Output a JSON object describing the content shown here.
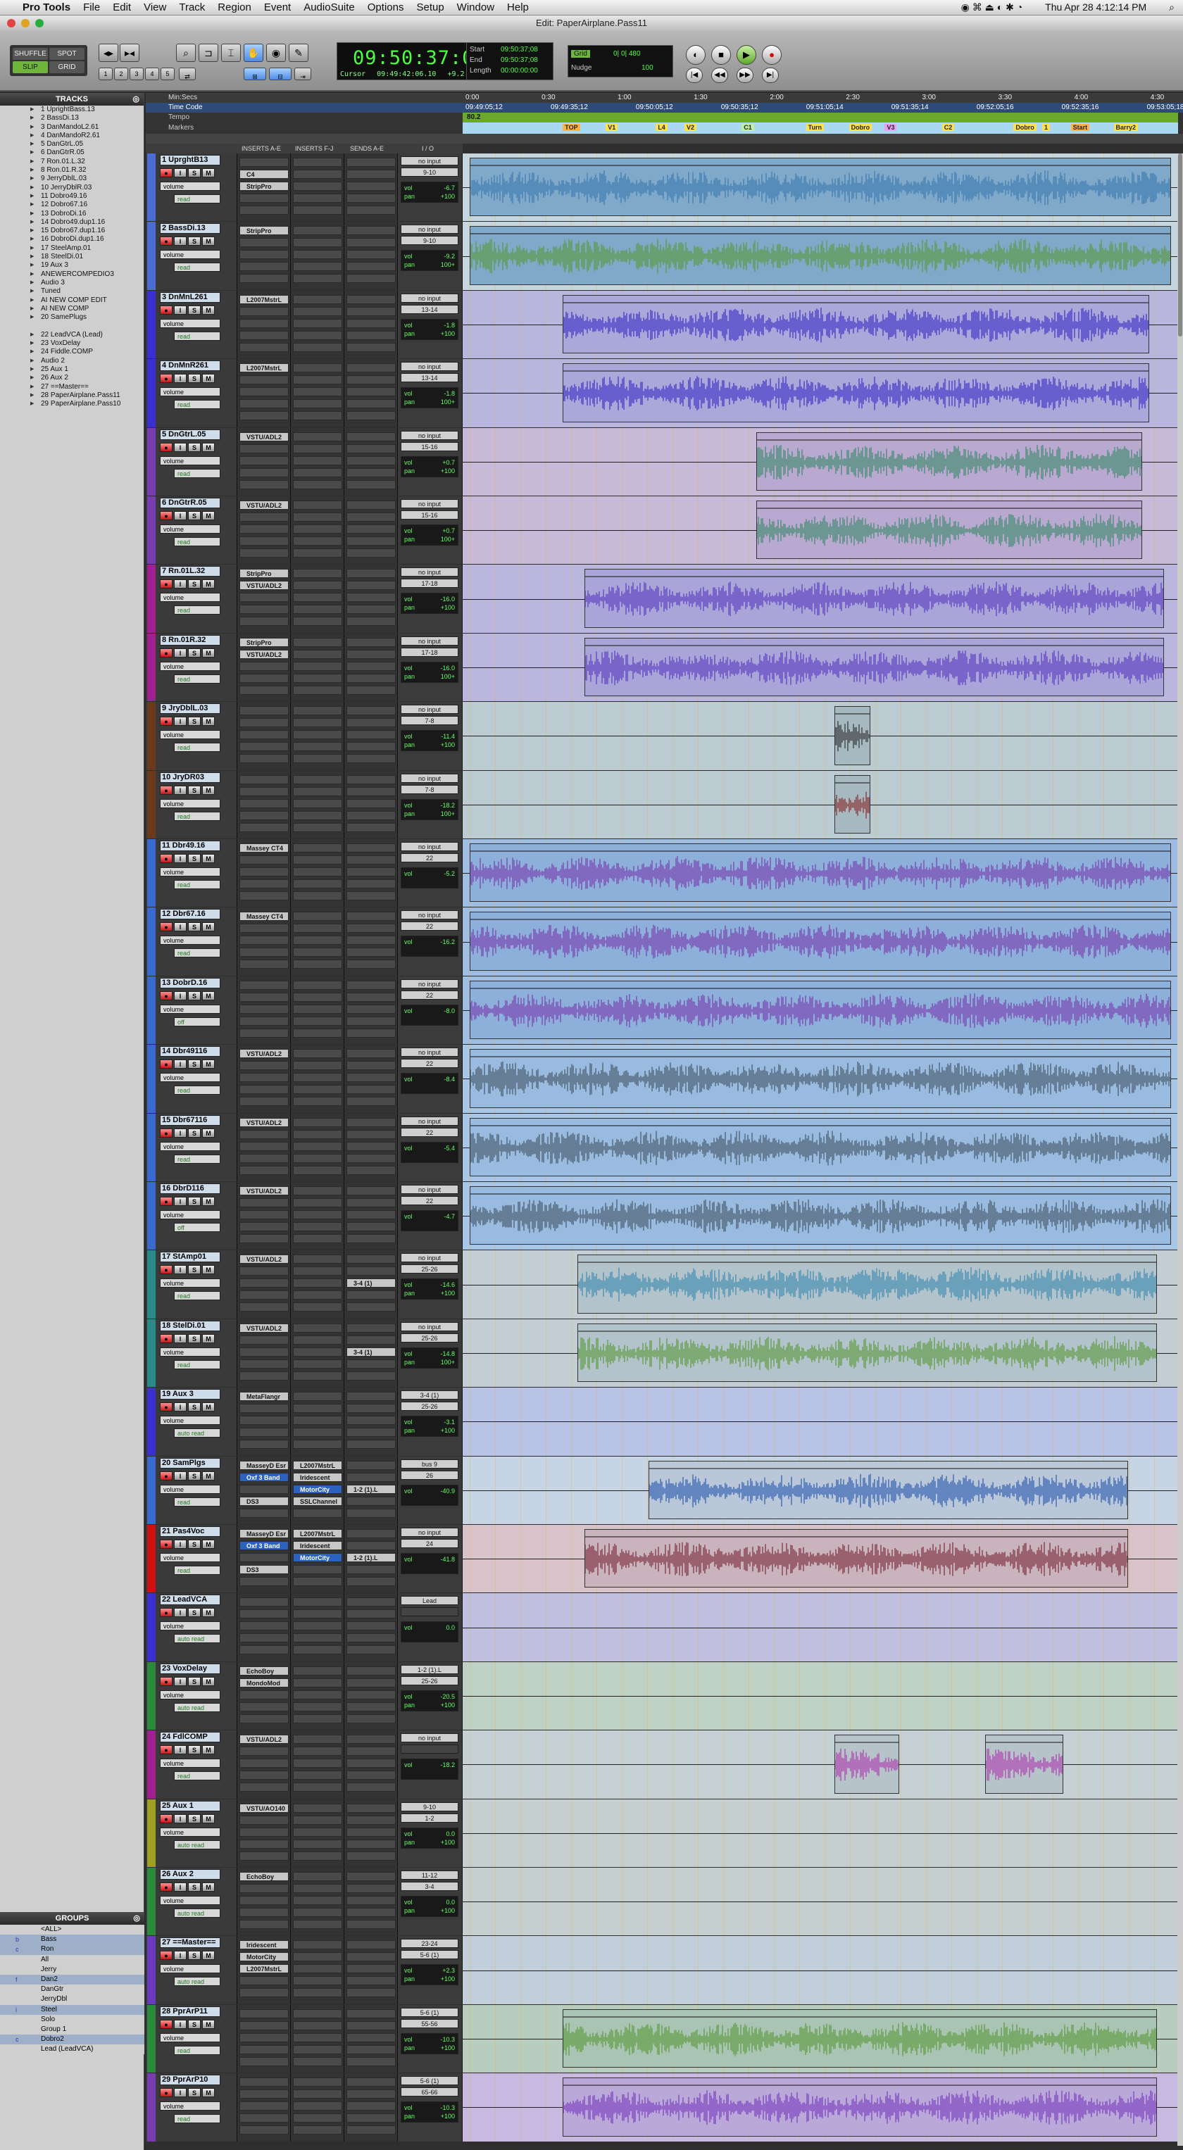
{
  "menubar": {
    "app": "Pro Tools",
    "items": [
      "File",
      "Edit",
      "View",
      "Track",
      "Region",
      "Event",
      "AudioSuite",
      "Options",
      "Setup",
      "Window",
      "Help"
    ],
    "clock": "Thu Apr 28  4:12:14 PM"
  },
  "window": {
    "title": "Edit: PaperAirplane.Pass11"
  },
  "toolbar": {
    "modes": [
      "SHUFFLE",
      "SPOT",
      "SLIP",
      "GRID"
    ],
    "zoom_presets": [
      "1",
      "2",
      "3",
      "4",
      "5"
    ],
    "main_counter": "09:50:37:08",
    "cursor_label": "Cursor",
    "cursor_value": "09:49:42:06.10",
    "cursor_db": "+9.2 db",
    "sel_start_label": "Start",
    "sel_end_label": "End",
    "sel_length_label": "Length",
    "sel_start": "09:50:37;08",
    "sel_end": "09:50:37;08",
    "sel_length": "00:00:00:00",
    "grid_label": "Grid",
    "grid_value": "0| 0| 480",
    "nudge_label": "Nudge",
    "nudge_value": "100",
    "transport": [
      "return",
      "stop",
      "play",
      "record"
    ]
  },
  "tracks_panel": {
    "title": "TRACKS",
    "items": [
      "1 UprightBass.13",
      "2 BassDi.13",
      "3 DanMandoL2.61",
      "4 DanMandoR2.61",
      "5 DanGtrL.05",
      "6 DanGtrR.05",
      "7 Ron.01.L.32",
      "8 Ron.01.R.32",
      "9 JerryDblL.03",
      "10 JerryDblR.03",
      "11 Dobro49.16",
      "12 Dobro67.16",
      "13 DobroDi.16",
      "14 Dobro49.dup1.16",
      "15 Dobro67.dup1.16",
      "16 DobroDi.dup1.16",
      "17 SteelAmp.01",
      "18 SteelDi.01",
      "19 Aux 3",
      "  ANEWERCOMPEDIO3",
      "Audio 3",
      "Tuned",
      "AI NEW COMP EDIT",
      "AI NEW COMP",
      "20 SamePlugs",
      "21 Pass4Voc",
      "22 LeadVCA (Lead)",
      "23 VoxDelay",
      "24 Fiddle.COMP",
      "Audio 2",
      "25 Aux 1",
      "26 Aux 2",
      "27 ==Master==",
      "28 PaperAirplane.Pass11",
      "29 PaperAirplane.Pass10"
    ],
    "selected_index": 25
  },
  "groups_panel": {
    "title": "GROUPS",
    "items": [
      {
        "letter": "",
        "name": "<ALL>"
      },
      {
        "letter": "b",
        "name": "Bass"
      },
      {
        "letter": "c",
        "name": "Ron"
      },
      {
        "letter": "",
        "name": "All"
      },
      {
        "letter": "",
        "name": "Jerry"
      },
      {
        "letter": "f",
        "name": "Dan2"
      },
      {
        "letter": "",
        "name": "DanGtr"
      },
      {
        "letter": "",
        "name": "JerryDbl"
      },
      {
        "letter": "i",
        "name": "Steel"
      },
      {
        "letter": "",
        "name": "Solo"
      },
      {
        "letter": "",
        "name": "Group 1"
      },
      {
        "letter": "c",
        "name": "Dobro2"
      },
      {
        "letter": "",
        "name": "Lead (LeadVCA)"
      }
    ]
  },
  "rulers": {
    "min_secs_label": "Min:Secs",
    "timecode_label": "Time Code",
    "tempo_label": "Tempo",
    "markers_label": "Markers",
    "min_secs_ticks": [
      "0:00",
      "0:30",
      "1:00",
      "1:30",
      "2:00",
      "2:30",
      "3:00",
      "3:30",
      "4:00",
      "4:30"
    ],
    "timecode_ticks": [
      "09:49:05;12",
      "09:49:35;12",
      "09:50:05;12",
      "09:50:35;12",
      "09:51:05;14",
      "09:51:35;14",
      "09:52:05;16",
      "09:52:35;16",
      "09:53:05;18"
    ],
    "tempo_value": "80.2",
    "markers": [
      "TOP",
      "V1",
      "L4",
      "V2",
      "C1",
      "Turn",
      "Dobro",
      "V3",
      "C2",
      "Dobro",
      "1",
      "Start",
      "Barry2"
    ]
  },
  "edit_headers": {
    "inserts_a": "INSERTS A-E",
    "inserts_f": "INSERTS F-J",
    "sends": "SENDS A-E",
    "io": "I / O"
  },
  "tracks": [
    {
      "name": "1 UprghtB13",
      "color": "#4a6cd4",
      "view": "volume",
      "auto": "read",
      "dyn": true,
      "insA": [
        "",
        "C4",
        "StripPro"
      ],
      "insF": [],
      "send": "",
      "input": "no input",
      "output": "9-10",
      "vol": "-6.7",
      "pan": "+100",
      "lane": "#c6d6df",
      "clips": [
        [
          0.01,
          0.99,
          "#7fa8c9",
          "#3a7ab0"
        ]
      ]
    },
    {
      "name": "2 BassDi.13",
      "color": "#4a6cd4",
      "view": "volume",
      "auto": "read",
      "dyn": true,
      "insA": [
        "StripPro"
      ],
      "insF": [],
      "send": "",
      "input": "no input",
      "output": "9-10",
      "vol": "-9.2",
      "pan": "100+",
      "lane": "#c6d6df",
      "clips": [
        [
          0.01,
          0.99,
          "#7fa8c9",
          "#5a9a3a"
        ]
      ]
    },
    {
      "name": "3 DnMnL261",
      "color": "#3a2fd0",
      "view": "volume",
      "auto": "read",
      "dyn": true,
      "insA": [
        "L2007MstrL"
      ],
      "insF": [],
      "send": "",
      "input": "no input",
      "output": "13-14",
      "vol": "-1.8",
      "pan": "+100",
      "lane": "#b9b6de",
      "clips": [
        [
          0.14,
          0.96,
          "#aaa8d8",
          "#3a2fc8"
        ]
      ]
    },
    {
      "name": "4 DnMnR261",
      "color": "#3a2fd0",
      "view": "volume",
      "auto": "read",
      "dyn": true,
      "insA": [
        "L2007MstrL"
      ],
      "insF": [],
      "send": "",
      "input": "no input",
      "output": "13-14",
      "vol": "-1.8",
      "pan": "100+",
      "lane": "#b9b6de",
      "clips": [
        [
          0.14,
          0.96,
          "#aaa8d8",
          "#3a2fc8"
        ]
      ]
    },
    {
      "name": "5 DnGtrL.05",
      "color": "#7a3ab0",
      "view": "volume",
      "auto": "read",
      "dyn": true,
      "insA": [
        "VSTU/ADL2"
      ],
      "insF": [],
      "send": "",
      "input": "no input",
      "output": "15-16",
      "vol": "+0.7",
      "pan": "+100",
      "lane": "#c7b9d8",
      "clips": [
        [
          0.41,
          0.95,
          "#b9a8d0",
          "#3a8a6a"
        ]
      ]
    },
    {
      "name": "6 DnGtrR.05",
      "color": "#7a3ab0",
      "view": "volume",
      "auto": "read",
      "dyn": true,
      "insA": [
        "VSTU/ADL2"
      ],
      "insF": [],
      "send": "",
      "input": "no input",
      "output": "15-16",
      "vol": "+0.7",
      "pan": "100+",
      "lane": "#c7b9d8",
      "clips": [
        [
          0.41,
          0.95,
          "#b9a8d0",
          "#3a8a6a"
        ]
      ]
    },
    {
      "name": "7 Rn.01L.32",
      "color": "#a02090",
      "view": "volume",
      "auto": "read",
      "dyn": true,
      "insA": [
        "StripPro",
        "VSTU/ADL2"
      ],
      "insF": [],
      "send": "",
      "input": "no input",
      "output": "17-18",
      "vol": "-16.0",
      "pan": "+100",
      "lane": "#bab6de",
      "clips": [
        [
          0.17,
          0.98,
          "#a9a5d8",
          "#5a3ac0"
        ]
      ]
    },
    {
      "name": "8 Rn.01R.32",
      "color": "#a02090",
      "view": "volume",
      "auto": "read",
      "dyn": true,
      "insA": [
        "StripPro",
        "VSTU/ADL2"
      ],
      "insF": [],
      "send": "",
      "input": "no input",
      "output": "17-18",
      "vol": "-16.0",
      "pan": "100+",
      "lane": "#bab6de",
      "clips": [
        [
          0.17,
          0.98,
          "#a9a5d8",
          "#5a3ac0"
        ]
      ]
    },
    {
      "name": "9 JryDblL.03",
      "color": "#6a3a1a",
      "view": "volume",
      "auto": "read",
      "dyn": true,
      "insA": [],
      "insF": [],
      "send": "",
      "input": "no input",
      "output": "7-8",
      "vol": "-11.4",
      "pan": "+100",
      "lane": "#bccbd1",
      "clips": [
        [
          0.52,
          0.57,
          "#a6b8c0",
          "#333333"
        ]
      ]
    },
    {
      "name": "10 JryDR03",
      "color": "#6a3a1a",
      "view": "volume",
      "auto": "read",
      "dyn": true,
      "insA": [],
      "insF": [],
      "send": "",
      "input": "no input",
      "output": "7-8",
      "vol": "-18.2",
      "pan": "100+",
      "lane": "#bccbd1",
      "clips": [
        [
          0.52,
          0.57,
          "#a6b8c0",
          "#8a2a2a"
        ]
      ]
    },
    {
      "name": "11 Dbr49.16",
      "color": "#3a6ad0",
      "view": "volume",
      "auto": "read",
      "dyn": true,
      "insA": [
        "Massey CT4"
      ],
      "insF": [],
      "send": "",
      "input": "no input",
      "output": "22",
      "vol": "-5.2",
      "pan": "",
      "lane": "#9fbde0",
      "clips": [
        [
          0.01,
          0.99,
          "#8db0da",
          "#7a3ab0"
        ]
      ]
    },
    {
      "name": "12 Dbr67.16",
      "color": "#3a6ad0",
      "view": "volume",
      "auto": "read",
      "dyn": true,
      "insA": [
        "Massey CT4"
      ],
      "insF": [],
      "send": "",
      "input": "no input",
      "output": "22",
      "vol": "-16.2",
      "pan": "",
      "lane": "#9fbde0",
      "clips": [
        [
          0.01,
          0.99,
          "#8db0da",
          "#7a3ab0"
        ]
      ]
    },
    {
      "name": "13 DobrD.16",
      "color": "#3a6ad0",
      "view": "volume",
      "auto": "off",
      "dyn": true,
      "insA": [],
      "insF": [],
      "send": "",
      "input": "no input",
      "output": "22",
      "vol": "-8.0",
      "pan": "",
      "lane": "#9fbde0",
      "clips": [
        [
          0.01,
          0.99,
          "#8db0da",
          "#7a3ab0"
        ]
      ]
    },
    {
      "name": "14 Dbr49116",
      "color": "#3a6ad0",
      "view": "volume",
      "auto": "read",
      "dyn": true,
      "insA": [
        "VSTU/ADL2"
      ],
      "insF": [],
      "send": "",
      "input": "no input",
      "output": "22",
      "vol": "-8.4",
      "pan": "",
      "lane": "#a8c6e6",
      "clips": [
        [
          0.01,
          0.99,
          "#98bbdf",
          "#445566"
        ]
      ]
    },
    {
      "name": "15 Dbr67116",
      "color": "#3a6ad0",
      "view": "volume",
      "auto": "read",
      "dyn": true,
      "insA": [
        "VSTU/ADL2"
      ],
      "insF": [],
      "send": "",
      "input": "no input",
      "output": "22",
      "vol": "-5.4",
      "pan": "",
      "lane": "#a8c6e6",
      "clips": [
        [
          0.01,
          0.99,
          "#98bbdf",
          "#445566"
        ]
      ]
    },
    {
      "name": "16 DbrD116",
      "color": "#3a6ad0",
      "view": "volume",
      "auto": "off",
      "dyn": true,
      "insA": [
        "VSTU/ADL2"
      ],
      "insF": [],
      "send": "",
      "input": "no input",
      "output": "22",
      "vol": "-4.7",
      "pan": "",
      "lane": "#a8c6e6",
      "clips": [
        [
          0.01,
          0.99,
          "#98bbdf",
          "#445566"
        ]
      ]
    },
    {
      "name": "17 StAmp01",
      "color": "#2a8a8a",
      "view": "volume",
      "auto": "read",
      "dyn": false,
      "insA": [
        "VSTU/ADL2"
      ],
      "insF": [],
      "send": "3-4 (1)",
      "input": "no input",
      "output": "25-26",
      "vol": "-14.6",
      "pan": "+100",
      "lane": "#c2ced3",
      "clips": [
        [
          0.16,
          0.97,
          "#b3c3cb",
          "#3a8ab0"
        ]
      ]
    },
    {
      "name": "18 StelDi.01",
      "color": "#2a8a8a",
      "view": "volume",
      "auto": "read",
      "dyn": true,
      "insA": [
        "VSTU/ADL2"
      ],
      "insF": [],
      "send": "3-4 (1)",
      "input": "no input",
      "output": "25-26",
      "vol": "-14.8",
      "pan": "100+",
      "lane": "#c2ced3",
      "clips": [
        [
          0.16,
          0.97,
          "#b3c3cb",
          "#5a9a3a"
        ]
      ]
    },
    {
      "name": "19 Aux 3",
      "color": "#3a2fd0",
      "view": "volume",
      "auto": "auto read",
      "dyn": false,
      "insA": [
        "MetaFlangr"
      ],
      "insF": [],
      "send": "",
      "input": "3-4 (1)",
      "output": "25-26",
      "vol": "-3.1",
      "pan": "+100",
      "lane": "#b9c3e6",
      "clips": []
    },
    {
      "name": "20 SamPlgs",
      "color": "#3a6ad0",
      "view": "volume",
      "auto": "read",
      "dyn": true,
      "insA": [
        "MasseyD Esr",
        "Oxf 3 Band",
        "",
        "DS3"
      ],
      "insF": [
        "L2007MstrL",
        "Iridescent",
        "MotorCity",
        "SSLChannel"
      ],
      "send": "1-2 (1).L",
      "input": "bus 9",
      "output": "26",
      "vol": "-40.9",
      "pan": "",
      "lane": "#c7d4e3",
      "clips": [
        [
          0.26,
          0.93,
          "#b9c7d8",
          "#2a5ab0"
        ]
      ]
    },
    {
      "name": "21 Pas4Voc",
      "color": "#d01010",
      "view": "volume",
      "auto": "read",
      "dyn": true,
      "insA": [
        "MasseyD Esr",
        "Oxf 3 Band",
        "",
        "DS3"
      ],
      "insF": [
        "L2007MstrL",
        "Iridescent",
        "MotorCity"
      ],
      "send": "1-2 (1).L",
      "input": "no input",
      "output": "24",
      "vol": "-41.8",
      "pan": "",
      "lane": "#d8c3cb",
      "clips": [
        [
          0.17,
          0.93,
          "#c9b3bc",
          "#7a2a3a"
        ]
      ]
    },
    {
      "name": "22 LeadVCA",
      "color": "#3a2fd0",
      "view": "volume",
      "auto": "auto read",
      "dyn": false,
      "insA": [],
      "insF": [],
      "send": "",
      "input": "Lead",
      "output": "",
      "vol": "0.0",
      "pan": "",
      "lane": "#c1bfe0",
      "clips": []
    },
    {
      "name": "23 VoxDelay",
      "color": "#2a8a3a",
      "view": "volume",
      "auto": "auto read",
      "dyn": false,
      "insA": [
        "EchoBoy",
        "MondoMod"
      ],
      "insF": [],
      "send": "",
      "input": "1-2 (1).L",
      "output": "25-26",
      "vol": "-20.5",
      "pan": "+100",
      "lane": "#bfd0c4",
      "clips": []
    },
    {
      "name": "24 FdlCOMP",
      "color": "#a02090",
      "view": "volume",
      "auto": "read",
      "dyn": true,
      "insA": [
        "VSTU/ADL2"
      ],
      "insF": [],
      "send": "",
      "input": "no input",
      "output": "",
      "vol": "-18.2",
      "pan": "",
      "lane": "#c6d1d6",
      "clips": [
        [
          0.52,
          0.61,
          "#b6c3c9",
          "#b03ab0"
        ],
        [
          0.73,
          0.84,
          "#b6c3c9",
          "#b03ab0"
        ]
      ]
    },
    {
      "name": "25 Aux 1",
      "color": "#a0a020",
      "view": "volume",
      "auto": "auto read",
      "dyn": false,
      "insA": [
        "VSTU/AO140"
      ],
      "insF": [],
      "send": "",
      "input": "9-10",
      "output": "1-2",
      "vol": "0.0",
      "pan": "+100",
      "lane": "#c6cfcf",
      "clips": []
    },
    {
      "name": "26 Aux 2",
      "color": "#2a8a3a",
      "view": "volume",
      "auto": "auto read",
      "dyn": false,
      "insA": [
        "EchoBoy"
      ],
      "insF": [],
      "send": "",
      "input": "11-12",
      "output": "3-4",
      "vol": "0.0",
      "pan": "+100",
      "lane": "#c6cfcf",
      "clips": []
    },
    {
      "name": "27 ==Master==",
      "color": "#6a3ac0",
      "view": "volume",
      "auto": "auto read",
      "dyn": false,
      "insA": [
        "Iridescent",
        "MotorCity",
        "L2007MstrL"
      ],
      "insF": [],
      "send": "",
      "input": "23-24",
      "output": "5-6 (1)",
      "vol": "+2.3",
      "pan": "+100",
      "lane": "#c2cfda",
      "clips": []
    },
    {
      "name": "28 PprArP11",
      "color": "#2a8a3a",
      "view": "volume",
      "auto": "read",
      "dyn": true,
      "insA": [],
      "insF": [],
      "send": "",
      "input": "5-6 (1)",
      "output": "55-56",
      "vol": "-10.3",
      "pan": "+100",
      "lane": "#b9cdbf",
      "clips": [
        [
          0.14,
          0.97,
          "#a9c4b2",
          "#5a9a3a"
        ]
      ]
    },
    {
      "name": "29 PprArP10",
      "color": "#7a3ab0",
      "view": "volume",
      "auto": "read",
      "dyn": true,
      "insA": [],
      "insF": [],
      "send": "",
      "input": "5-6 (1)",
      "output": "65-66",
      "vol": "-10.3",
      "pan": "+100",
      "lane": "#c7b9e0",
      "clips": [
        [
          0.14,
          0.97,
          "#b9a8d8",
          "#7a3ac0"
        ]
      ]
    }
  ],
  "track_buttons": {
    "rec": "●",
    "input": "I",
    "solo": "S",
    "mute": "M"
  }
}
